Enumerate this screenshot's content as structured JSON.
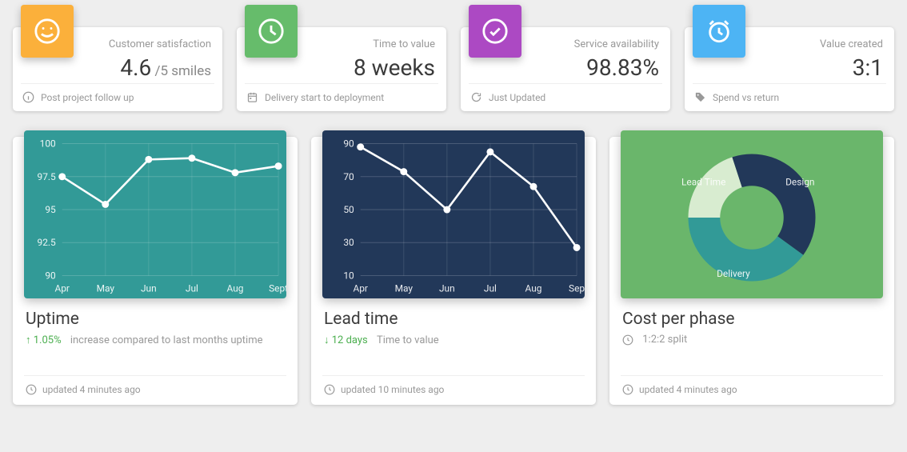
{
  "colors": {
    "orange": "#fbb03b",
    "green": "#66bc6b",
    "purple": "#ac49c3",
    "blue": "#4db4f4",
    "teal": "#329a97",
    "navy": "#223859",
    "leaf": "#6ab66b"
  },
  "stats": [
    {
      "icon": "smile",
      "iconColor": "#fbb03b",
      "label": "Customer satisfaction",
      "value": "4.6",
      "suffix": " /5 smiles",
      "footIcon": "info",
      "foot": "Post project follow up"
    },
    {
      "icon": "clock",
      "iconColor": "#66bc6b",
      "label": "Time to value",
      "value": "8 weeks",
      "suffix": "",
      "footIcon": "calendar",
      "foot": "Delivery start to deployment"
    },
    {
      "icon": "check",
      "iconColor": "#ac49c3",
      "label": "Service availability",
      "value": "98.83%",
      "suffix": "",
      "footIcon": "refresh",
      "foot": "Just Updated"
    },
    {
      "icon": "alarm",
      "iconColor": "#4db4f4",
      "label": "Value created",
      "value": "3:1",
      "suffix": "",
      "footIcon": "tag",
      "foot": "Spend vs return"
    }
  ],
  "charts": [
    {
      "bg": "#329a97",
      "title": "Uptime",
      "trend": {
        "dir": "up",
        "txt": "1.05%",
        "rest": "increase compared to last months uptime"
      },
      "foot": "updated 4 minutes ago"
    },
    {
      "bg": "#223859",
      "title": "Lead time",
      "trend": {
        "dir": "down",
        "txt": "12 days",
        "rest": "Time to value"
      },
      "foot": "updated 10 minutes ago"
    },
    {
      "bg": "#6ab66b",
      "title": "Cost per phase",
      "trend": {
        "dir": "clock",
        "txt": "",
        "rest": "1:2:2 split"
      },
      "foot": "updated 4 minutes ago"
    }
  ],
  "chart_data": [
    {
      "type": "line",
      "title": "Uptime",
      "categories": [
        "Apr",
        "May",
        "Jun",
        "Jul",
        "Aug",
        "Sept"
      ],
      "values": [
        97.5,
        95.4,
        98.8,
        98.9,
        97.8,
        98.3
      ],
      "ylim": [
        90,
        100
      ],
      "yticks": [
        90,
        92.5,
        95,
        97.5,
        100
      ]
    },
    {
      "type": "line",
      "title": "Lead time",
      "categories": [
        "Apr",
        "May",
        "Jun",
        "Jul",
        "Aug",
        "Sep"
      ],
      "values": [
        88,
        73,
        50,
        85,
        64,
        27
      ],
      "ylim": [
        10,
        90
      ],
      "yticks": [
        10,
        30,
        50,
        70,
        90
      ]
    },
    {
      "type": "donut",
      "title": "Cost per phase",
      "series": [
        {
          "name": "Lead Time",
          "value": 1
        },
        {
          "name": "Design",
          "value": 2
        },
        {
          "name": "Delivery",
          "value": 2
        }
      ],
      "colors": [
        "#d8ecd0",
        "#223859",
        "#329a97"
      ]
    }
  ]
}
